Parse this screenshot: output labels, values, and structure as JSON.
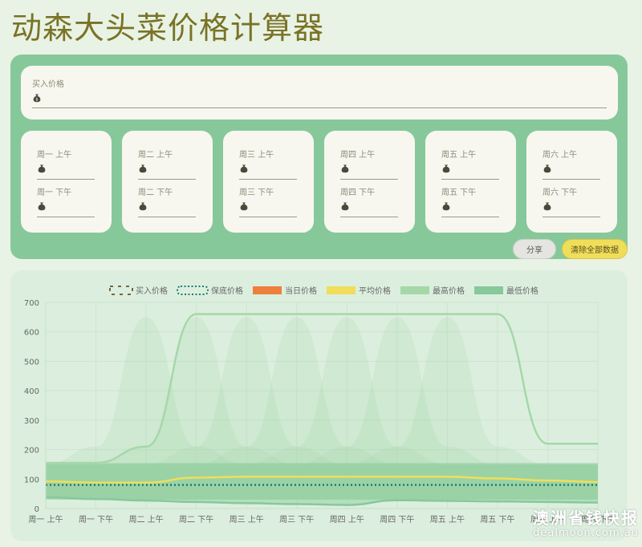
{
  "title": "动森大头菜价格计算器",
  "buy": {
    "label": "买入价格",
    "value": ""
  },
  "days": [
    {
      "am_label": "周一 上午",
      "pm_label": "周一 下午"
    },
    {
      "am_label": "周二 上午",
      "pm_label": "周二 下午"
    },
    {
      "am_label": "周三 上午",
      "pm_label": "周三 下午"
    },
    {
      "am_label": "周四 上午",
      "pm_label": "周四 下午"
    },
    {
      "am_label": "周五 上午",
      "pm_label": "周五 下午"
    },
    {
      "am_label": "周六 上午",
      "pm_label": "周六 下午"
    }
  ],
  "buttons": {
    "share": "分享",
    "clear": "清除全部数据"
  },
  "colors": {
    "buy": "#7a6440",
    "guarantee": "#1e7a72",
    "today": "#ee7f3c",
    "average": "#f0de5a",
    "max": "#a5d8a8",
    "min": "#86c99a"
  },
  "icons": {
    "money_bag": "money-bag-icon"
  },
  "chart_data": {
    "type": "line",
    "legend": [
      "买入价格",
      "保底价格",
      "当日价格",
      "平均价格",
      "最高价格",
      "最低价格"
    ],
    "legend_position": "top",
    "categories": [
      "周一 上午",
      "周一 下午",
      "周二 上午",
      "周二 下午",
      "周三 上午",
      "周三 下午",
      "周四 上午",
      "周四 下午",
      "周五 上午",
      "周五 下午",
      "周六 上午",
      "周六 下午"
    ],
    "yticks": [
      0,
      100,
      200,
      300,
      400,
      500,
      600,
      700
    ],
    "ylim": [
      0,
      700
    ],
    "grid": true,
    "series": [
      {
        "name": "最高价格",
        "values": [
          155,
          155,
          210,
          660,
          660,
          660,
          660,
          660,
          660,
          660,
          220,
          220
        ]
      },
      {
        "name": "最低价格",
        "values": [
          38,
          32,
          27,
          22,
          18,
          15,
          12,
          28,
          26,
          24,
          22,
          20
        ]
      },
      {
        "name": "平均价格",
        "values": [
          92,
          88,
          88,
          105,
          108,
          108,
          108,
          108,
          108,
          102,
          95,
          90
        ]
      },
      {
        "name": "保底价格",
        "values": [
          80,
          80,
          80,
          80,
          80,
          80,
          80,
          80,
          80,
          80,
          80,
          80
        ]
      }
    ]
  },
  "watermark": {
    "main": "澳洲省钱快报",
    "sub": "dealmoon.com.au"
  }
}
